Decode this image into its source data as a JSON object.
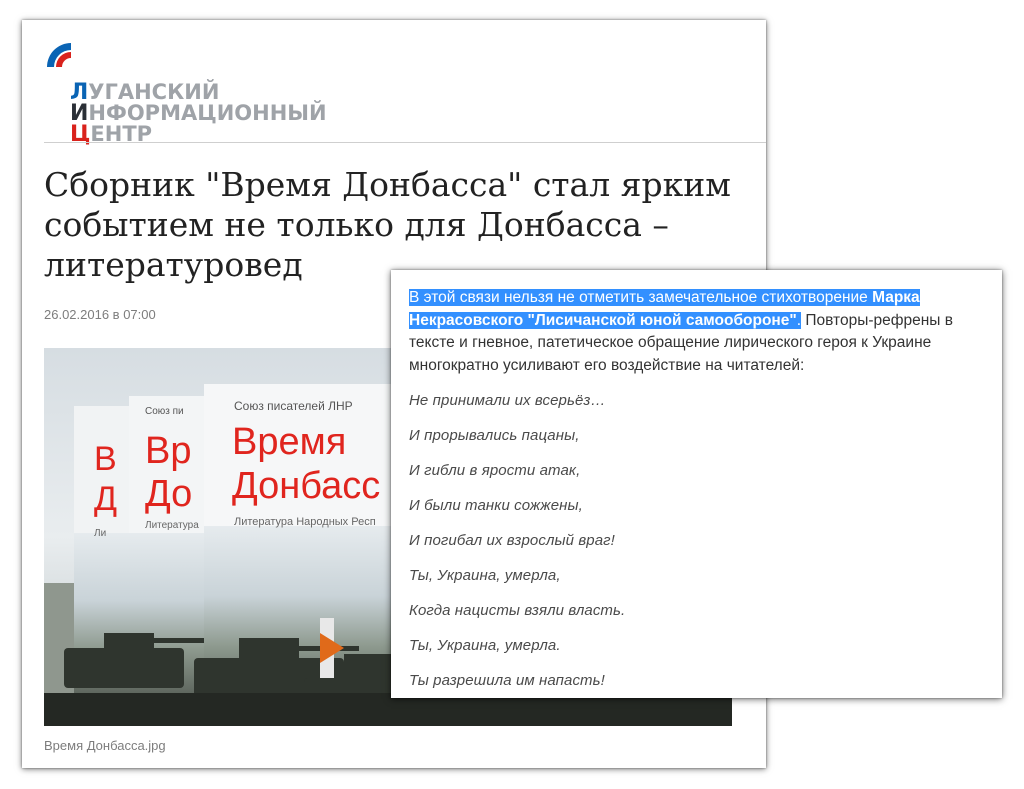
{
  "logo": {
    "lines": [
      {
        "initial": "Л",
        "rest": "УГАНСКИЙ"
      },
      {
        "initial": "И",
        "rest": "НФОРМАЦИОННЫЙ"
      },
      {
        "initial": "Ц",
        "rest": "ЕНТР"
      }
    ]
  },
  "article": {
    "headline_lines": [
      "Сборник \"Время Донбасса\" стал ярким",
      "событием не только для Донбасса –",
      "литературовед"
    ],
    "date": "26.02.2016 в 07:00",
    "photo": {
      "book_publisher": "Союз писателей ЛНР",
      "book_publisher_short": "Союз пи",
      "book_title_line1": "Время",
      "book_title_line2": "Донбасс",
      "book_title_mid1": "Вр",
      "book_title_mid2": "До",
      "book_title_back1": "В",
      "book_title_back2": "Д",
      "book_subtitle": "Литература Народных Респ",
      "book_subtitle_short": "Литература",
      "book_subtitle_back": "Ли"
    },
    "caption": "Время Донбасса.jpg"
  },
  "excerpt": {
    "highlight_plain": "В этой связи нельзя не отметить замечательное стихотворение ",
    "highlight_bold": "Марка Некрасовского \"Лисичанской юной самообороне\"",
    "highlight_tail": ".",
    "rest": " Повторы-рефрены в тексте и гневное, патетическое обращение лирического героя к Украине многократно усиливают его воздействие на читателей:",
    "poem": [
      "Не принимали их всерьёз…",
      "И прорывались пацаны,",
      "И гибли в ярости атак,",
      "И были танки сожжены,",
      "И погибал их взрослый враг!",
      "Ты, Украина, умерла,",
      "Когда нацисты взяли власть.",
      "Ты, Украина, умерла.",
      "Ты разрешила им напасть!"
    ]
  },
  "colors": {
    "logo_blue": "#0a64b4",
    "logo_red": "#d9221c",
    "logo_gray": "#9fa3a8",
    "selection": "#3390ff",
    "book_title_red": "#e0251e"
  }
}
